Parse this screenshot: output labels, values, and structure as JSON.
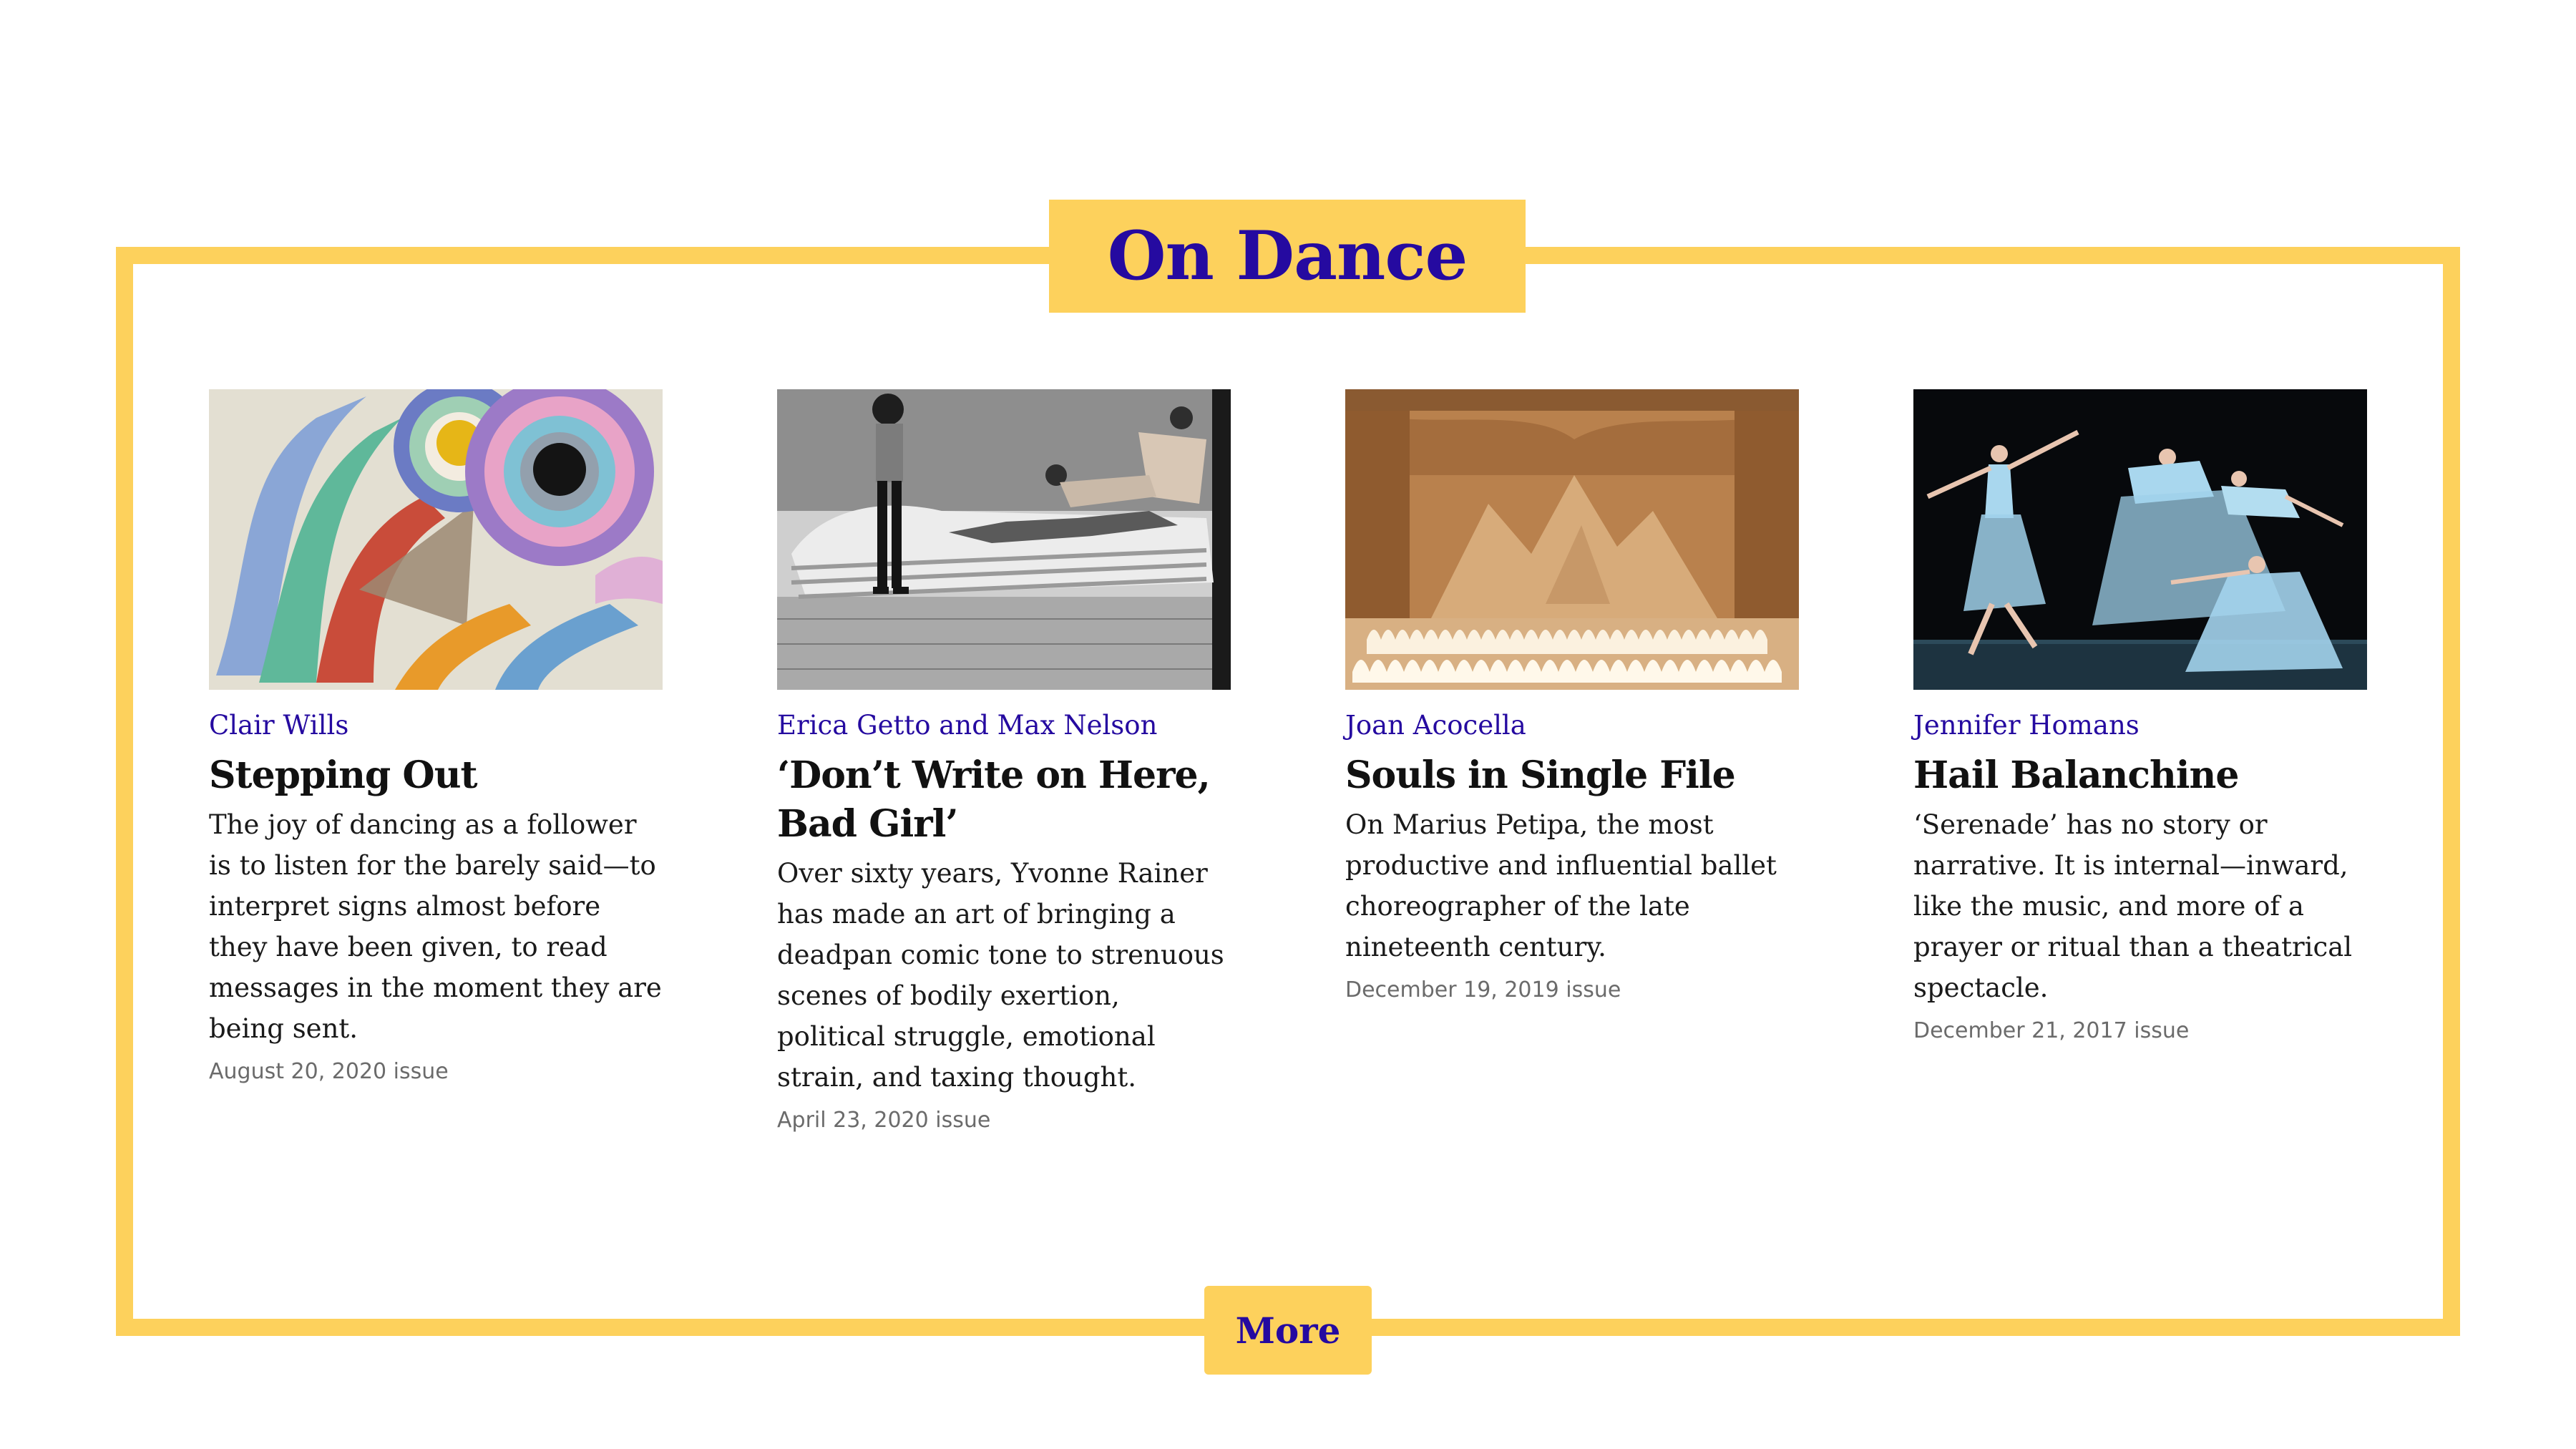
{
  "section": {
    "title": "On Dance",
    "more_label": "More"
  },
  "colors": {
    "accent_yellow": "#fdd15c",
    "brand_indigo": "#250aa0"
  },
  "articles": [
    {
      "author": "Clair Wills",
      "title": "Stepping Out",
      "dek": "The joy of dancing as a follower is to listen for the barely said—to interpret signs almost before they have been given, to read messages in the moment they are being sent.",
      "issue": "August 20, 2020 issue",
      "image_icon": "abstract-painting-image"
    },
    {
      "author": "Erica Getto and Max Nelson",
      "title": "‘Don’t Write on Here, Bad Girl’",
      "dek": "Over sixty years, Yvonne Rainer has made an art of bringing a deadpan comic tone to strenuous scenes of bodily exertion, political struggle, emotional strain, and taxing thought.",
      "issue": "April 23, 2020 issue",
      "image_icon": "dance-rehearsal-photo"
    },
    {
      "author": "Joan Acocella",
      "title": "Souls in Single File",
      "dek": "On Marius Petipa, the most productive and influential ballet choreographer of the late nineteenth century.",
      "issue": "December 19, 2019 issue",
      "image_icon": "ballet-stage-photo"
    },
    {
      "author": "Jennifer Homans",
      "title": "Hail Balanchine",
      "dek": "‘Serenade’ has no story or narrative. It is internal—inward, like the music, and more of a prayer or ritual than a theatrical spectacle.",
      "issue": "December 21, 2017 issue",
      "image_icon": "ballerinas-photo"
    }
  ]
}
